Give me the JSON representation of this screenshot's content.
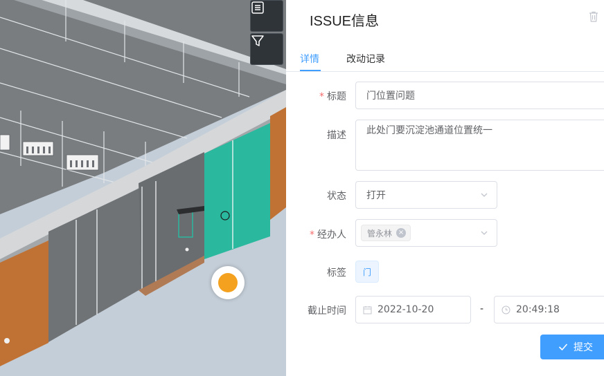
{
  "viewer": {
    "toolbar": [
      {
        "icon": "list-icon"
      },
      {
        "icon": "filter-icon"
      }
    ],
    "marker": {
      "color": "#f4a11f"
    }
  },
  "issue": {
    "title": "ISSUE信息",
    "tabs": [
      {
        "label": "详情",
        "active": true
      },
      {
        "label": "改动记录",
        "active": false
      }
    ],
    "form": {
      "title_label": "标题",
      "title_value": "门位置问题",
      "desc_label": "描述",
      "desc_value": "此处门要沉淀池通道位置统一",
      "status_label": "状态",
      "status_value": "打开",
      "assignee_label": "经办人",
      "assignee_chip": "管永林",
      "tags_label": "标签",
      "tag_value": "门",
      "deadline_label": "截止时间",
      "date_value": "2022-10-20",
      "date_separator": "-",
      "time_value": "20:49:18"
    },
    "submit_label": "提交"
  },
  "colors": {
    "accent": "#409eff",
    "required": "#f56c6c",
    "teal_wall": "#2ab89e",
    "orange_wall": "#c07134"
  }
}
